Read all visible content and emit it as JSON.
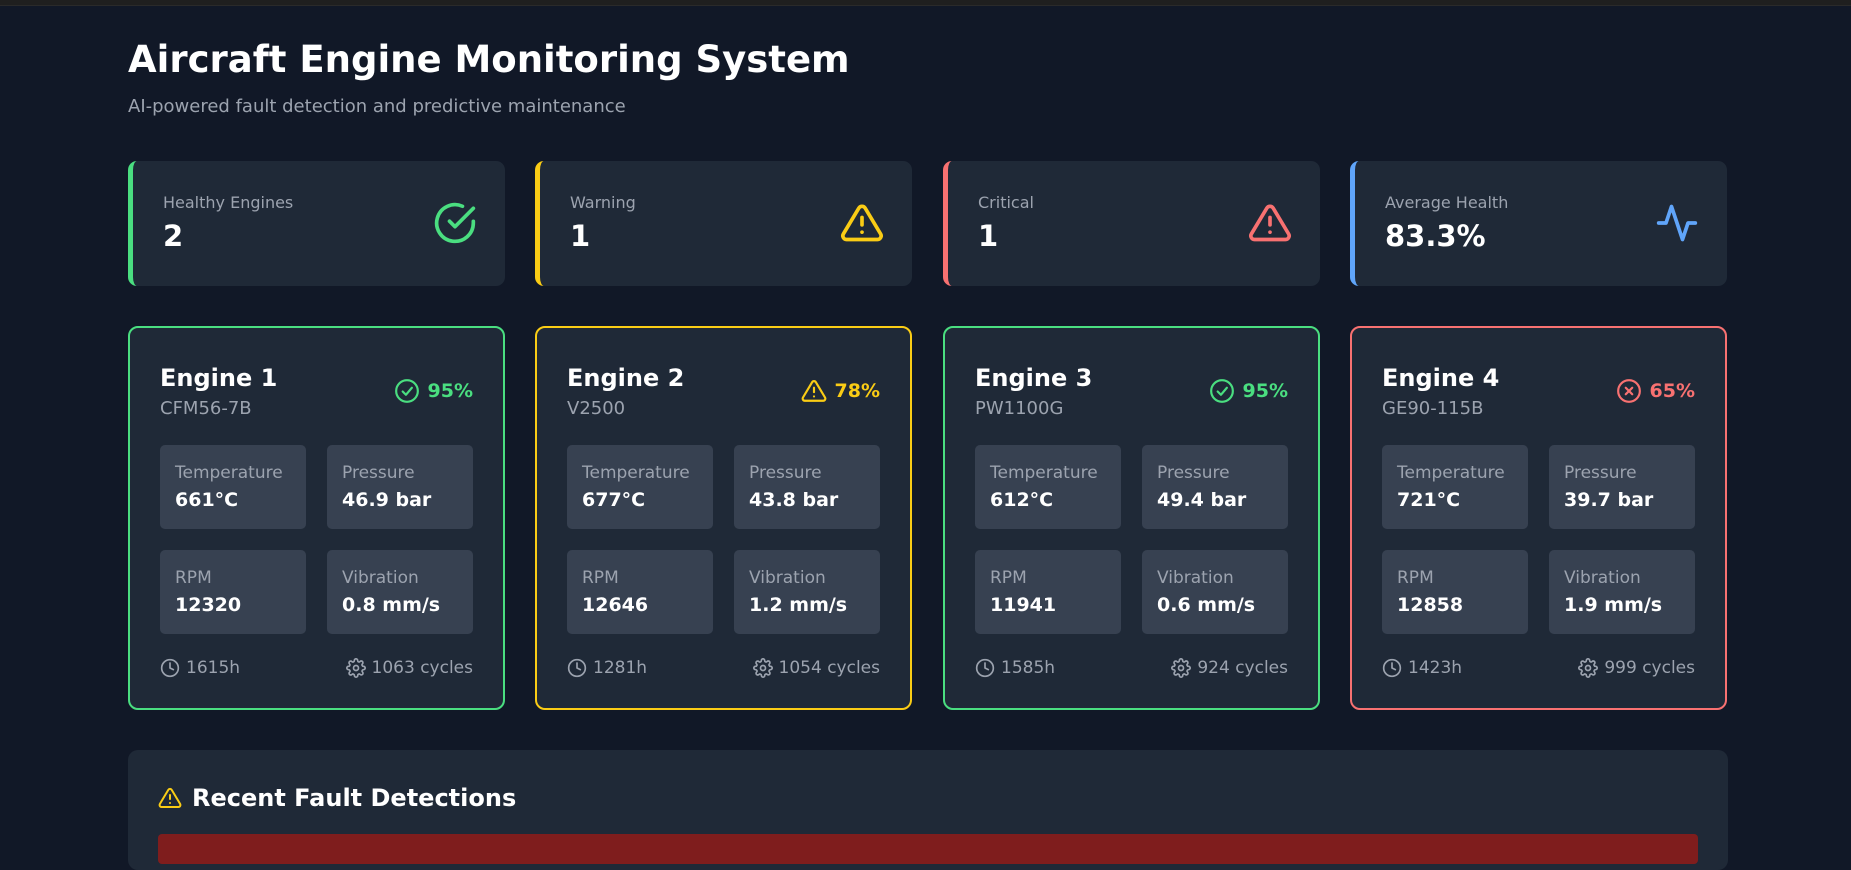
{
  "header": {
    "title": "Aircraft Engine Monitoring System",
    "subtitle": "AI-powered fault detection and predictive maintenance"
  },
  "colors": {
    "healthy": "#4ade80",
    "warning": "#facc15",
    "critical": "#f87171",
    "info": "#60a5fa",
    "card": "#1f2937",
    "background": "#111827"
  },
  "stats": [
    {
      "label": "Healthy Engines",
      "value": "2",
      "icon": "check-circle-icon"
    },
    {
      "label": "Warning",
      "value": "1",
      "icon": "alert-triangle-icon"
    },
    {
      "label": "Critical",
      "value": "1",
      "icon": "alert-triangle-icon"
    },
    {
      "label": "Average Health",
      "value": "83.3%",
      "icon": "activity-icon"
    }
  ],
  "engines": [
    {
      "name": "Engine 1",
      "model": "CFM56-7B",
      "status": "healthy",
      "status_icon": "check-circle-icon",
      "health": "95%",
      "metrics": [
        {
          "label": "Temperature",
          "value": "661°C"
        },
        {
          "label": "Pressure",
          "value": "46.9 bar"
        },
        {
          "label": "RPM",
          "value": "12320"
        },
        {
          "label": "Vibration",
          "value": "0.8 mm/s"
        }
      ],
      "hours": "1615h",
      "cycles": "1063 cycles"
    },
    {
      "name": "Engine 2",
      "model": "V2500",
      "status": "warning",
      "status_icon": "alert-triangle-icon",
      "health": "78%",
      "metrics": [
        {
          "label": "Temperature",
          "value": "677°C"
        },
        {
          "label": "Pressure",
          "value": "43.8 bar"
        },
        {
          "label": "RPM",
          "value": "12646"
        },
        {
          "label": "Vibration",
          "value": "1.2 mm/s"
        }
      ],
      "hours": "1281h",
      "cycles": "1054 cycles"
    },
    {
      "name": "Engine 3",
      "model": "PW1100G",
      "status": "healthy",
      "status_icon": "check-circle-icon",
      "health": "95%",
      "metrics": [
        {
          "label": "Temperature",
          "value": "612°C"
        },
        {
          "label": "Pressure",
          "value": "49.4 bar"
        },
        {
          "label": "RPM",
          "value": "11941"
        },
        {
          "label": "Vibration",
          "value": "0.6 mm/s"
        }
      ],
      "hours": "1585h",
      "cycles": "924 cycles"
    },
    {
      "name": "Engine 4",
      "model": "GE90-115B",
      "status": "critical",
      "status_icon": "x-circle-icon",
      "health": "65%",
      "metrics": [
        {
          "label": "Temperature",
          "value": "721°C"
        },
        {
          "label": "Pressure",
          "value": "39.7 bar"
        },
        {
          "label": "RPM",
          "value": "12858"
        },
        {
          "label": "Vibration",
          "value": "1.9 mm/s"
        }
      ],
      "hours": "1423h",
      "cycles": "999 cycles"
    }
  ],
  "faults": {
    "title": "Recent Fault Detections",
    "icon": "alert-triangle-icon"
  }
}
